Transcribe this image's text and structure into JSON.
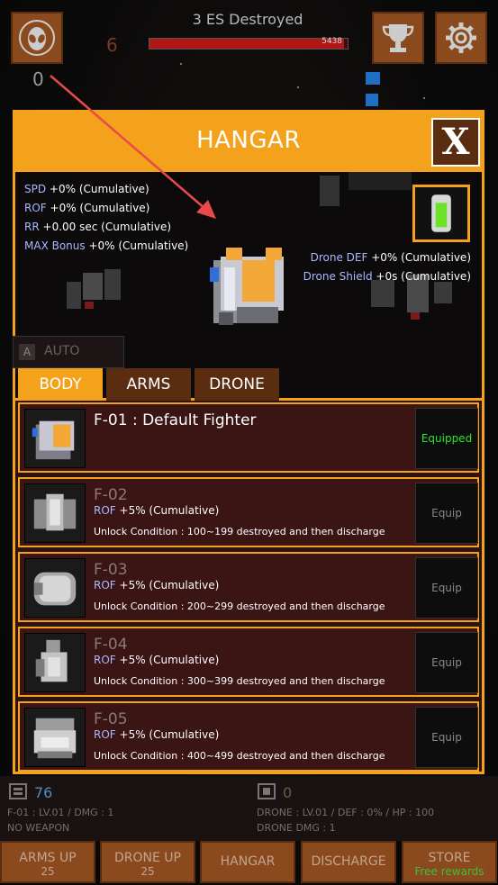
{
  "top": {
    "title": "3 ES Destroyed",
    "level": "6",
    "kills": "0",
    "hp_text": "5438",
    "hp_fraction": 0.98
  },
  "hangar": {
    "title": "HANGAR",
    "close_label": "X",
    "stats_left": [
      {
        "key": "SPD",
        "value": "+0% (Cumulative)"
      },
      {
        "key": "ROF",
        "value": "+0% (Cumulative)"
      },
      {
        "key": "RR",
        "value": "+0.00 sec (Cumulative)"
      },
      {
        "key": "MAX Bonus",
        "value": "+0% (Cumulative)"
      }
    ],
    "stats_right": [
      {
        "key": "Drone DEF",
        "value": "+0% (Cumulative)"
      },
      {
        "key": "Drone Shield",
        "value": "+0s (Cumulative)"
      }
    ],
    "auto_label": "AUTO",
    "auto_badge": "A",
    "tabs": [
      {
        "label": "BODY",
        "active": true
      },
      {
        "label": "ARMS",
        "active": false
      },
      {
        "label": "DRONE",
        "active": false
      }
    ],
    "items": [
      {
        "name": "F-01 : Default Fighter",
        "stat_key": "",
        "stat_value": "",
        "condition": "",
        "button": "Equipped",
        "equipped": true
      },
      {
        "name": "F-02",
        "stat_key": "ROF",
        "stat_value": "+5% (Cumulative)",
        "condition": "Unlock Condition : 100~199 destroyed and then discharge",
        "button": "Equip",
        "equipped": false
      },
      {
        "name": "F-03",
        "stat_key": "ROF",
        "stat_value": "+5% (Cumulative)",
        "condition": "Unlock Condition : 200~299 destroyed and then discharge",
        "button": "Equip",
        "equipped": false
      },
      {
        "name": "F-04",
        "stat_key": "ROF",
        "stat_value": "+5% (Cumulative)",
        "condition": "Unlock Condition : 300~399 destroyed and then discharge",
        "button": "Equip",
        "equipped": false
      },
      {
        "name": "F-05",
        "stat_key": "ROF",
        "stat_value": "+5% (Cumulative)",
        "condition": "Unlock Condition : 400~499 destroyed and then discharge",
        "button": "Equip",
        "equipped": false
      }
    ]
  },
  "bottom": {
    "arms_count": "76",
    "drone_count": "0",
    "fighter_line": "F-01 : LV.01 / DMG : 1",
    "weapon_line": "NO WEAPON",
    "drone_line": "DRONE : LV.01 / DEF : 0% / HP : 100",
    "drone_dmg_line": "DRONE DMG : 1",
    "buttons": [
      {
        "label": "ARMS UP",
        "sub": "25"
      },
      {
        "label": "DRONE UP",
        "sub": "25"
      },
      {
        "label": "HANGAR",
        "sub": ""
      },
      {
        "label": "DISCHARGE",
        "sub": ""
      },
      {
        "label": "STORE",
        "sub": "Free rewards"
      }
    ]
  },
  "colors": {
    "accent": "#f4a11b",
    "panel_bg": "#2a1312",
    "button_brown": "#8a4a1e",
    "equipped_green": "#2de52d",
    "stat_key_blue": "#a9b8ff"
  },
  "icons": [
    "alien-icon",
    "trophy-icon",
    "gear-icon",
    "close-icon",
    "fighter-icon",
    "drone-icon"
  ]
}
